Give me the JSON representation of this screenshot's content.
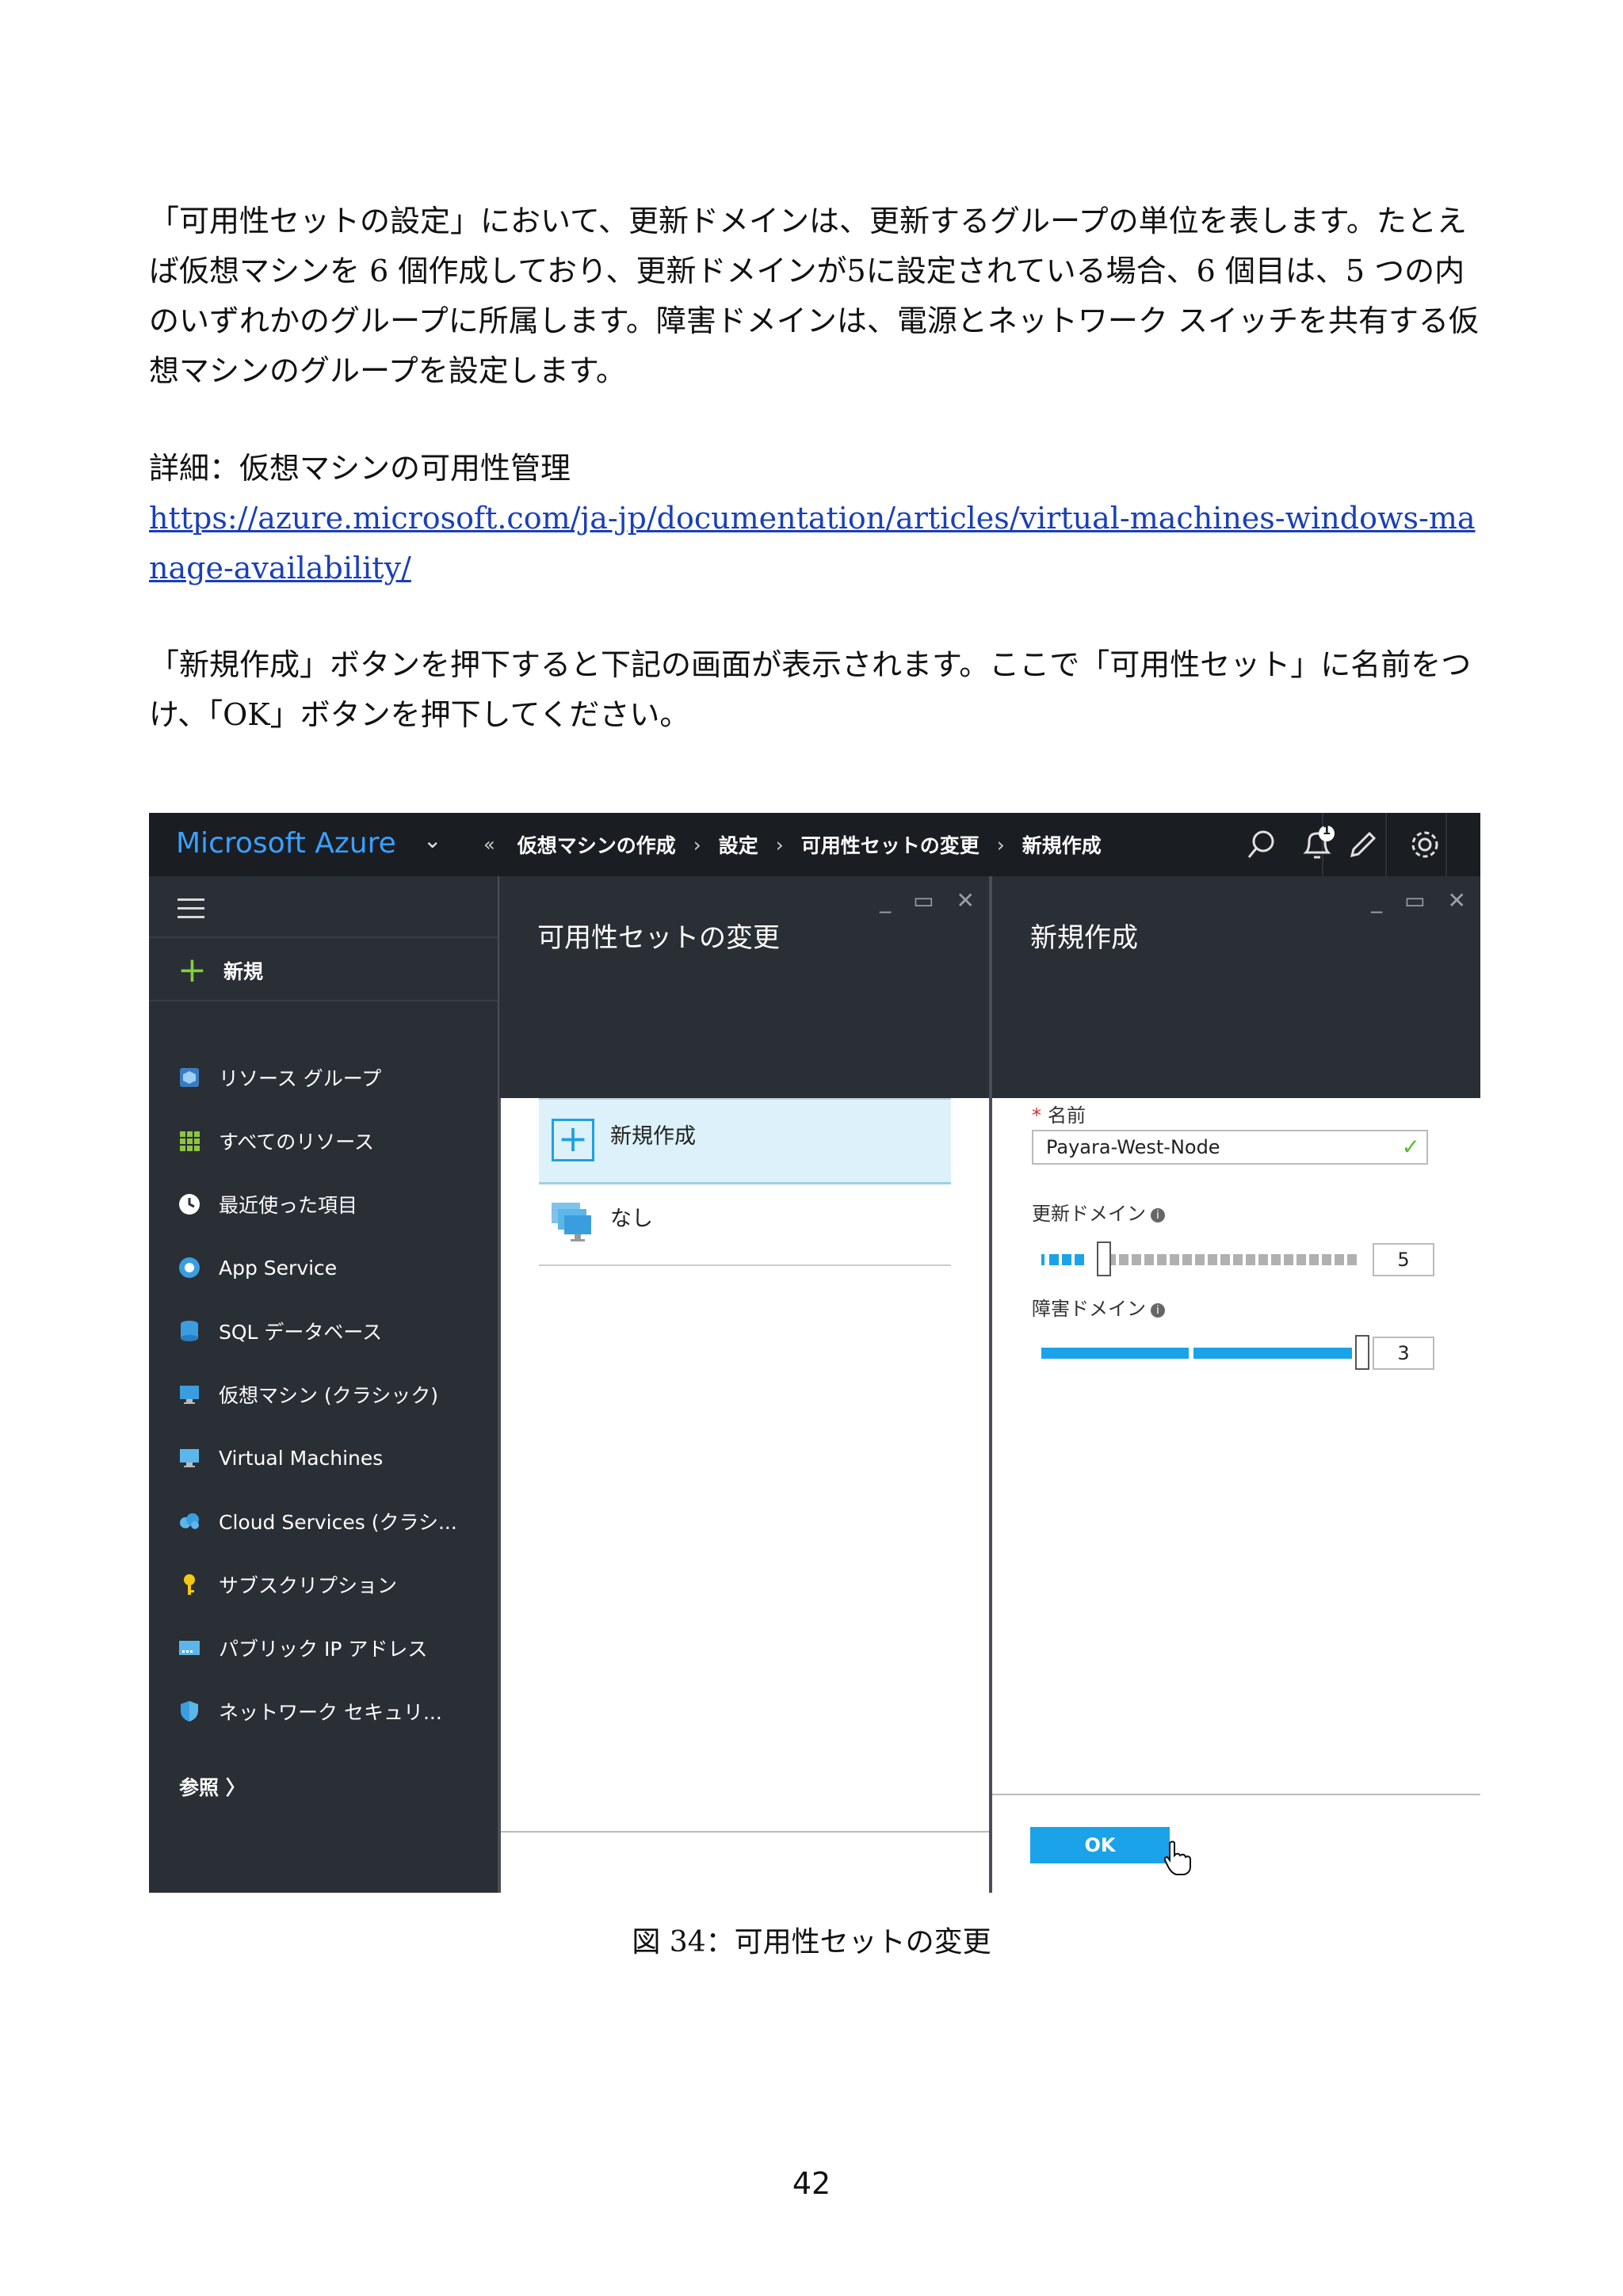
{
  "document": {
    "paragraph1": "「可用性セットの設定」において、更新ドメインは、更新するグループの単位を表します。たとえば仮想マシンを 6 個作成しており、更新ドメインが5に設定されている場合、6 個目は、5 つの内のいずれかのグループに所属します。障害ドメインは、電源とネットワーク スイッチを共有する仮想マシンのグループを設定します。",
    "paragraph2": "詳細：仮想マシンの可用性管理",
    "link": "https://azure.microsoft.com/ja-jp/documentation/articles/virtual-machines-windows-manage-availability/",
    "paragraph3": "「新規作成」ボタンを押下すると下記の画面が表示されます。ここで「可用性セット」に名前をつけ、「OK」ボタンを押下してください。",
    "caption": "図 34：可用性セットの変更",
    "page_number": "42"
  },
  "screenshot": {
    "brand": "Microsoft Azure",
    "breadcrumb": {
      "back": "«",
      "items": [
        "仮想マシンの作成",
        "設定",
        "可用性セットの変更",
        "新規作成"
      ]
    },
    "notification_count": "1",
    "sidebar": {
      "new_label": "新規",
      "items": [
        {
          "label": "リソース グループ",
          "icon": "resource-group-icon"
        },
        {
          "label": "すべてのリソース",
          "icon": "all-resources-icon"
        },
        {
          "label": "最近使った項目",
          "icon": "clock-icon"
        },
        {
          "label": "App Service",
          "icon": "app-service-icon"
        },
        {
          "label": "SQL データベース",
          "icon": "sql-database-icon"
        },
        {
          "label": "仮想マシン (クラシック)",
          "icon": "vm-classic-icon"
        },
        {
          "label": "Virtual Machines",
          "icon": "virtual-machines-icon"
        },
        {
          "label": "Cloud Services (クラシ...",
          "icon": "cloud-services-icon"
        },
        {
          "label": "サブスクリプション",
          "icon": "key-icon"
        },
        {
          "label": "パブリック IP アドレス",
          "icon": "public-ip-icon"
        },
        {
          "label": "ネットワーク セキュリ...",
          "icon": "shield-icon"
        }
      ],
      "browse_label": "参照 〉"
    },
    "blade1": {
      "title": "可用性セットの変更",
      "items": [
        "新規作成",
        "なし"
      ]
    },
    "blade2": {
      "title": "新規作成",
      "name_label": "名前",
      "name_value": "Payara-West-Node",
      "update_domain_label": "更新ドメイン",
      "update_domain_value": "5",
      "fault_domain_label": "障害ドメイン",
      "fault_domain_value": "3",
      "ok_label": "OK"
    },
    "colors": {
      "accent": "#1aa3e8",
      "brand": "#3aa0ff",
      "nav_bg": "#2a2e35"
    }
  }
}
